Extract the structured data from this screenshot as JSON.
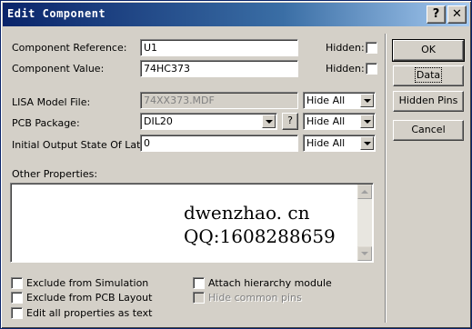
{
  "window": {
    "title": "Edit Component",
    "help_glyph": "?",
    "close_glyph": "✕"
  },
  "fields": {
    "reference_label": "Component Reference:",
    "reference_value": "U1",
    "value_label": "Component Value:",
    "value_value": "74HC373",
    "hidden_label_1": "Hidden:",
    "hidden_label_2": "Hidden:",
    "lisa_label": "LISA Model File:",
    "lisa_value": "74XX373.MDF",
    "lisa_visibility": "Hide All",
    "pcb_label": "PCB Package:",
    "pcb_value": "DIL20",
    "pcb_help": "?",
    "pcb_visibility": "Hide All",
    "latch_label": "Initial Output State Of Latch:",
    "latch_value": "0",
    "latch_visibility": "Hide All"
  },
  "other_properties": {
    "label": "Other Properties:",
    "watermark_line1": "dwenzhao. cn",
    "watermark_line2": "QQ:1608288659"
  },
  "checkboxes": {
    "exclude_sim": "Exclude from Simulation",
    "exclude_pcb": "Exclude from PCB Layout",
    "edit_all": "Edit all properties as text",
    "attach_hierarchy": "Attach hierarchy module",
    "hide_common_pins": "Hide common pins"
  },
  "buttons": {
    "ok": "OK",
    "data": "Data",
    "hidden_pins": "Hidden Pins",
    "cancel": "Cancel"
  }
}
